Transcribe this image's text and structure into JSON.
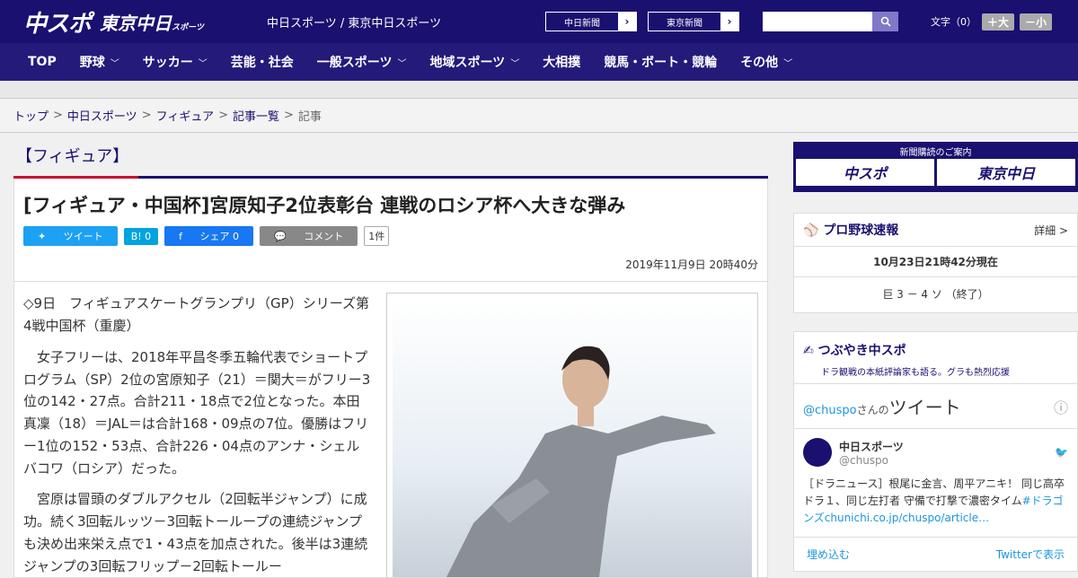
{
  "header": {
    "logo1": "中スポ",
    "logo2": "東京中日",
    "logo2_sub": "スポーツ",
    "site_name": "中日スポーツ / 東京中日スポーツ",
    "paper1": "中日新聞",
    "paper2": "東京新聞",
    "font_size_label": "文字（0）",
    "font_plus": "＋大",
    "font_minus": "－小"
  },
  "nav": [
    "TOP",
    "野球",
    "サッカー",
    "芸能・社会",
    "一般スポーツ",
    "地域スポーツ",
    "大相撲",
    "競馬・ボート・競輪",
    "その他"
  ],
  "breadcrumb": [
    "トップ",
    "中日スポーツ",
    "フィギュア",
    "記事一覧",
    "記事"
  ],
  "category": "【フィギュア】",
  "article": {
    "title": "[フィギュア・中国杯]宮原知子2位表彰台 連戦のロシア杯へ大きな弾み",
    "tweet": "ツイート",
    "hatena": "B! 0",
    "share": "シェア 0",
    "comment": "コメント",
    "comment_count": "1件",
    "date": "2019年11月9日 20時40分",
    "paragraphs": [
      "◇9日　フィギュアスケートグランプリ（GP）シリーズ第4戦中国杯（重慶）",
      "　女子フリーは、2018年平昌冬季五輪代表でショートプログラム（SP）2位の宮原知子（21）＝関大＝がフリー3位の142・27点。合計211・18点で2位となった。本田真凜（18）＝JAL＝は合計168・09点の7位。優勝はフリー1位の152・53点、合計226・04点のアンナ・シェルバコワ（ロシア）だった。",
      "　宮原は冒頭のダブルアクセル（2回転半ジャンプ）に成功。続く3回転ルッツ－3回転トーループの連続ジャンプも決め出来栄え点で1・43点を加点された。後半は3連続ジャンプの3回転フリップ－2回転トールー"
    ]
  },
  "sidebar": {
    "subscribe_title": "新聞購読のご案内",
    "sub_logo1": "中スポ",
    "sub_logo2": "東京中日",
    "baseball_title": "プロ野球速報",
    "baseball_more": "詳細 >",
    "baseball_time": "10月23日21時42分現在",
    "baseball_score": "巨 3 － 4 ソ （終了）",
    "tsubuyaki_title": "つぶやき中スポ",
    "tsubuyaki_sub": "ドラ観戦の本紙評論家も語る。グラも熱烈応援",
    "tweets_head_user": "@chuspo",
    "tweets_head_mid": "さんの",
    "tweets_head_word": "ツイート",
    "tweet_name": "中日スポーツ",
    "tweet_handle": "@chuspo",
    "tweet_text": "［ドラニュース］根尾に金言、周平アニキ！ 同じ高卒ドラ１、同じ左打者 守備で打撃で濃密タイム",
    "tweet_link": "#ドラゴンズ",
    "tweet_url": "chunichi.co.jp/chuspo/article…",
    "embed": "埋め込む",
    "view_on_twitter": "Twitterで表示"
  }
}
